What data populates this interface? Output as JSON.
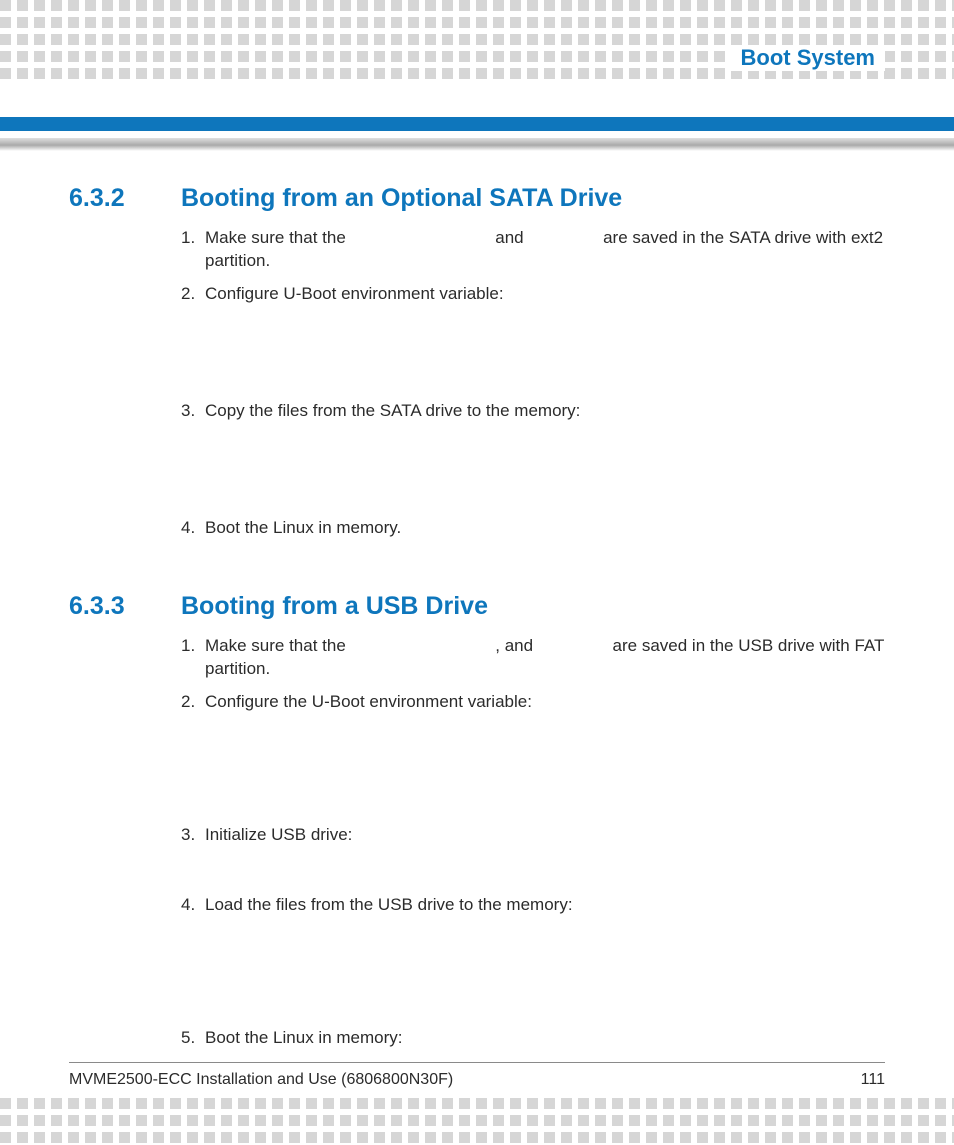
{
  "header": {
    "chapter_title": "Boot System"
  },
  "sections": [
    {
      "number": "6.3.2",
      "title": "Booting from an Optional SATA Drive",
      "steps": [
        {
          "n": "1.",
          "prefix": "Make sure that the ",
          "mid": " and ",
          "suffix": " are  saved in the SATA drive with ext2 partition."
        },
        {
          "n": "2.",
          "text": "Configure U-Boot environment variable:"
        },
        {
          "n": "3.",
          "text": "Copy the files from the SATA drive to the memory:"
        },
        {
          "n": "4.",
          "text": "Boot the Linux in memory."
        }
      ]
    },
    {
      "number": "6.3.3",
      "title": "Booting from a USB Drive",
      "steps": [
        {
          "n": "1.",
          "prefix": "Make sure that the ",
          "mid": ", and ",
          "suffix": " are saved in the USB drive with FAT partition."
        },
        {
          "n": "2.",
          "text": "Configure the U-Boot environment variable:"
        },
        {
          "n": "3.",
          "text": "Initialize USB drive:"
        },
        {
          "n": "4.",
          "text": "Load the files from the USB drive to the memory:"
        },
        {
          "n": "5.",
          "text": "Boot the Linux in memory:"
        }
      ]
    }
  ],
  "footer": {
    "doc": "MVME2500-ECC Installation and Use (6806800N30F)",
    "page": "111"
  }
}
